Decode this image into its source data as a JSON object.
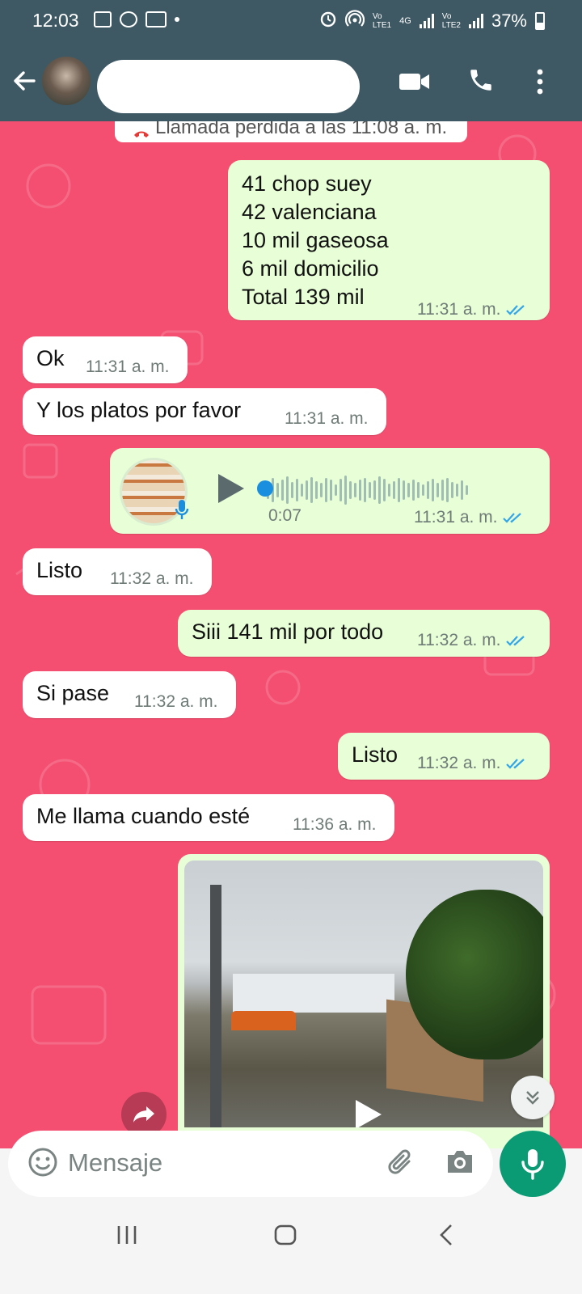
{
  "status_bar": {
    "time": "12:03",
    "battery": "37%",
    "sim1": "LTE1",
    "sim2": "LTE2",
    "net": "4G"
  },
  "header": {
    "contact_name": "",
    "icons": [
      "back-arrow-icon",
      "video-call-icon",
      "phone-icon",
      "more-vert-icon"
    ]
  },
  "system_message": {
    "text": "Llamada perdida a las 11:08 a. m."
  },
  "messages": [
    {
      "direction": "out",
      "lines": [
        "41 chop suey",
        "42 valenciana",
        "10 mil gaseosa",
        "6 mil domicilio",
        "Total 139 mil"
      ],
      "time": "11:31 a. m.",
      "status": "read"
    },
    {
      "direction": "in",
      "text": "Ok",
      "time": "11:31 a. m."
    },
    {
      "direction": "in",
      "text": "Y los platos por favor",
      "time": "11:31 a. m."
    },
    {
      "direction": "out",
      "type": "voice",
      "duration": "0:07",
      "time": "11:31 a. m.",
      "status": "read"
    },
    {
      "direction": "in",
      "text": "Listo",
      "time": "11:32 a. m."
    },
    {
      "direction": "out",
      "text": "Siii 141 mil por todo",
      "time": "11:32 a. m.",
      "status": "read"
    },
    {
      "direction": "in",
      "text": "Si pase",
      "time": "11:32 a. m."
    },
    {
      "direction": "out",
      "text": "Listo",
      "time": "11:32 a. m.",
      "status": "read"
    },
    {
      "direction": "in",
      "text": "Me llama cuando esté",
      "time": "11:36 a. m."
    },
    {
      "direction": "out",
      "type": "video"
    }
  ],
  "composer": {
    "placeholder": "Mensaje"
  },
  "colors": {
    "header": "#3f5964",
    "chat_bg": "#f44f70",
    "out_bubble": "#e7fed6",
    "in_bubble": "#ffffff",
    "read_ticks": "#34a6e8",
    "mic_button": "#0a9b74"
  }
}
